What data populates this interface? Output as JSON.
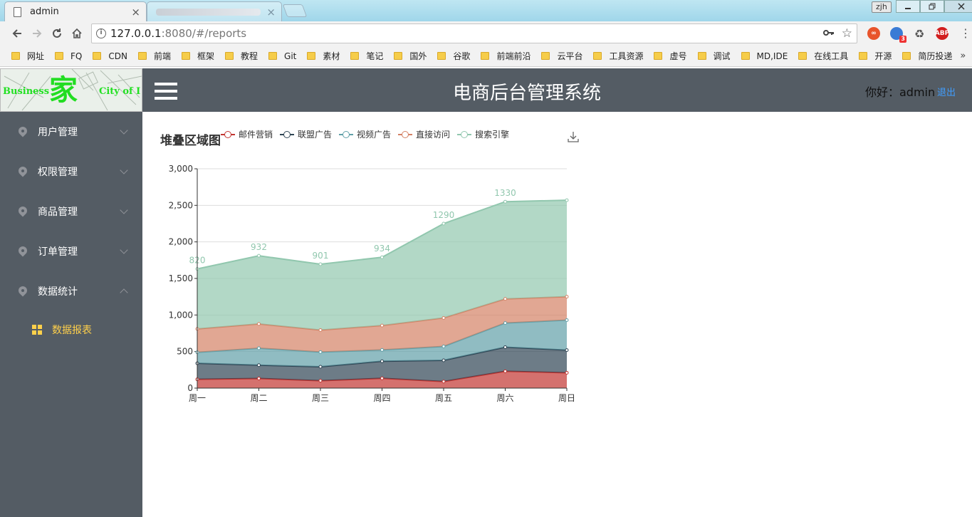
{
  "browser": {
    "tab_title": "admin",
    "tab_close": "×",
    "profile": "zjh",
    "url_host": "127.0.0.1",
    "url_rest": ":8080/#/reports",
    "ext_badge": "3",
    "ext_abp": "ABP"
  },
  "bookmarks": [
    "网址",
    "FQ",
    "CDN",
    "前端",
    "框架",
    "教程",
    "Git",
    "素材",
    "笔记",
    "国外",
    "谷歌",
    "前端前沿",
    "云平台",
    "工具资源",
    "虚号",
    "调试",
    "MD,IDE",
    "在线工具",
    "开源",
    "简历投递"
  ],
  "bookmarks_more": "»",
  "header": {
    "logo_left": "Business",
    "logo_mid": "家",
    "logo_right": "City of I",
    "title": "电商后台管理系统",
    "greeting": "你好：admin",
    "logout": "退出"
  },
  "sidebar": {
    "items": [
      {
        "label": "用户管理"
      },
      {
        "label": "权限管理"
      },
      {
        "label": "商品管理"
      },
      {
        "label": "订单管理"
      },
      {
        "label": "数据统计"
      }
    ],
    "sub_item": "数据报表"
  },
  "colors": {
    "sidebar_bg": "#545c64",
    "active": "#ffd04b",
    "link": "#409eff",
    "series": [
      "#c23531",
      "#2f4554",
      "#61a0a8",
      "#d48265",
      "#91c7ae"
    ]
  },
  "chart_data": {
    "type": "area",
    "title": "堆叠区域图",
    "categories": [
      "周一",
      "周二",
      "周三",
      "周四",
      "周五",
      "周六",
      "周日"
    ],
    "ylim": [
      0,
      3000
    ],
    "yticks": [
      "0",
      "500",
      "1,000",
      "1,500",
      "2,000",
      "2,500",
      "3,000"
    ],
    "grid": "horizontal",
    "legend_position": "top",
    "stacked": true,
    "series": [
      {
        "name": "邮件营销",
        "values": [
          120,
          132,
          101,
          134,
          90,
          230,
          210
        ]
      },
      {
        "name": "联盟广告",
        "values": [
          220,
          182,
          191,
          234,
          290,
          330,
          310
        ]
      },
      {
        "name": "视频广告",
        "values": [
          150,
          232,
          201,
          154,
          190,
          330,
          410
        ]
      },
      {
        "name": "直接访问",
        "values": [
          320,
          332,
          301,
          334,
          390,
          330,
          320
        ]
      },
      {
        "name": "搜索引擎",
        "values": [
          820,
          932,
          901,
          934,
          1290,
          1330,
          1320
        ]
      }
    ],
    "data_labels": [
      "820",
      "932",
      "901",
      "934",
      "1290",
      "1330"
    ]
  }
}
